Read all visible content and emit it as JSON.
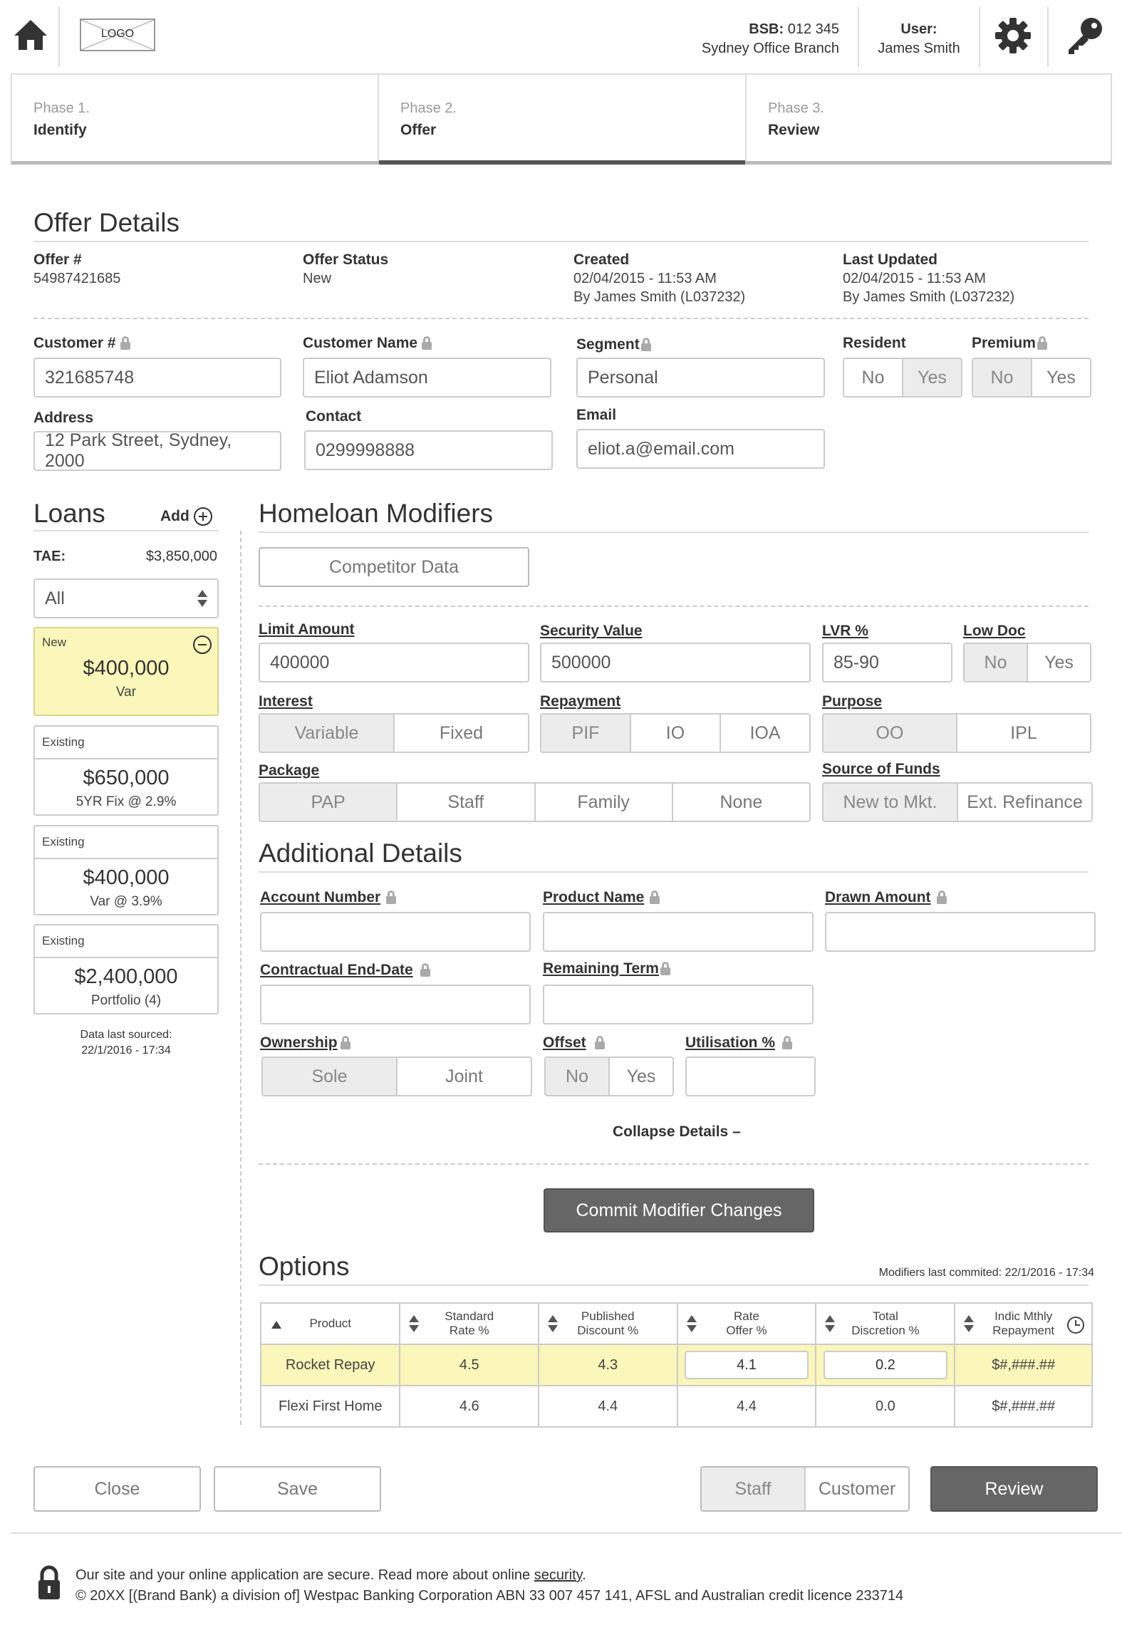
{
  "header": {
    "logo_text": "LOGO",
    "bsb_label": "BSB:",
    "bsb_value": "012 345",
    "branch": "Sydney Office Branch",
    "user_label": "User:",
    "user_name": "James Smith"
  },
  "phases": [
    {
      "num": "Phase 1.",
      "name": "Identify"
    },
    {
      "num": "Phase 2.",
      "name": "Offer"
    },
    {
      "num": "Phase 3.",
      "name": "Review"
    }
  ],
  "offer": {
    "title": "Offer Details",
    "offer_no_label": "Offer #",
    "offer_no": "54987421685",
    "status_label": "Offer Status",
    "status": "New",
    "created_label": "Created",
    "created_date": "02/04/2015 - 11:53 AM",
    "created_by": "By James Smith (L037232)",
    "updated_label": "Last Updated",
    "updated_date": "02/04/2015 - 11:53 AM",
    "updated_by": "By James Smith (L037232)"
  },
  "customer": {
    "number_label": "Customer #",
    "number": "321685748",
    "name_label": "Customer Name",
    "name": "Eliot Adamson",
    "segment_label": "Segment",
    "segment": "Personal",
    "resident_label": "Resident",
    "premium_label": "Premium",
    "no": "No",
    "yes": "Yes",
    "address_label": "Address",
    "address": "12 Park Street, Sydney, 2000",
    "contact_label": "Contact",
    "contact": "0299998888",
    "email_label": "Email",
    "email": "eliot.a@email.com"
  },
  "loans": {
    "title": "Loans",
    "add_label": "Add",
    "tae_label": "TAE:",
    "tae_value": "$3,850,000",
    "filter": "All",
    "items": [
      {
        "tag": "New",
        "amount": "$400,000",
        "sub": "Var"
      },
      {
        "tag": "Existing",
        "amount": "$650,000",
        "sub": "5YR Fix @ 2.9%"
      },
      {
        "tag": "Existing",
        "amount": "$400,000",
        "sub": "Var @ 3.9%"
      },
      {
        "tag": "Existing",
        "amount": "$2,400,000",
        "sub": "Portfolio (4)"
      }
    ],
    "sourced_label": "Data last sourced:",
    "sourced_date": "22/1/2016 - 17:34"
  },
  "modifiers": {
    "title": "Homeloan Modifiers",
    "competitor_btn": "Competitor Data",
    "limit_label": "Limit Amount",
    "limit": "400000",
    "security_label": "Security Value",
    "security": "500000",
    "lvr_label": "LVR %",
    "lvr": "85-90",
    "lowdoc_label": "Low Doc",
    "interest_label": "Interest",
    "interest_opts": [
      "Variable",
      "Fixed"
    ],
    "repayment_label": "Repayment",
    "repayment_opts": [
      "PIF",
      "IO",
      "IOA"
    ],
    "purpose_label": "Purpose",
    "purpose_opts": [
      "OO",
      "IPL"
    ],
    "package_label": "Package",
    "package_opts": [
      "PAP",
      "Staff",
      "Family",
      "None"
    ],
    "funds_label": "Source of Funds",
    "funds_opts": [
      "New to Mkt.",
      "Ext. Refinance"
    ]
  },
  "additional": {
    "title": "Additional Details",
    "account_label": "Account Number",
    "product_label": "Product Name",
    "drawn_label": "Drawn Amount",
    "enddate_label": "Contractual End-Date",
    "term_label": "Remaining Term",
    "ownership_label": "Ownership",
    "ownership_opts": [
      "Sole",
      "Joint"
    ],
    "offset_label": "Offset",
    "utilisation_label": "Utilisation %",
    "collapse": "Collapse Details"
  },
  "commit_btn": "Commit Modifier Changes",
  "options": {
    "title": "Options",
    "committed": "Modifiers last commited: 22/1/2016 - 17:34",
    "headers": [
      [
        "Product",
        ""
      ],
      [
        "Standard",
        "Rate %"
      ],
      [
        "Published",
        "Discount %"
      ],
      [
        "Rate",
        "Offer %"
      ],
      [
        "Total",
        "Discretion %"
      ],
      [
        "Indic Mthly",
        "Repayment"
      ]
    ],
    "rows": [
      [
        "Rocket Repay",
        "4.5",
        "4.3",
        "4.1",
        "0.2",
        "$#,###.##"
      ],
      [
        "Flexi First Home",
        "4.6",
        "4.4",
        "4.4",
        "0.0",
        "$#,###.##"
      ]
    ]
  },
  "footer_buttons": {
    "close": "Close",
    "save": "Save",
    "staff": "Staff",
    "customer": "Customer",
    "review": "Review"
  },
  "legal": {
    "secure_prefix": "Our site and your online application are secure. Read more about online",
    "security_link": "security",
    "copyright": "© 20XX [(Brand Bank) a division of] Westpac Banking Corporation ABN 33 007 457 141, AFSL and Australian credit licence 233714"
  }
}
